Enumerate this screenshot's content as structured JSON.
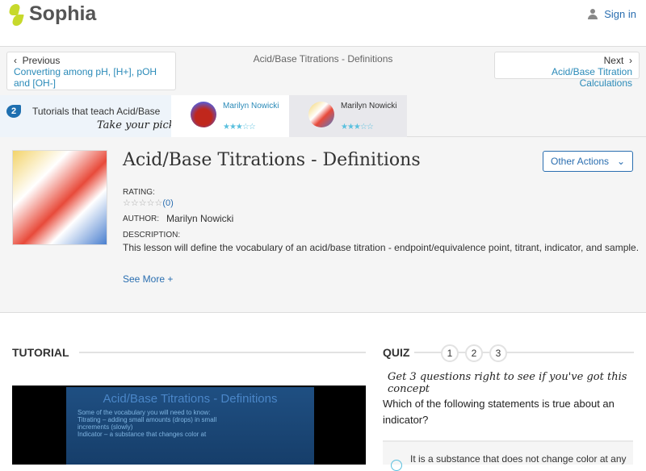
{
  "header": {
    "brand": "Sophia",
    "signin": "Sign in"
  },
  "nav": {
    "previous_label": "Previous",
    "previous_link": "Converting among pH, [H+], pOH and [OH-]",
    "current": "Acid/Base Titrations - Definitions",
    "next_label": "Next",
    "next_link": "Acid/Base Titration Calculations"
  },
  "tutorials": {
    "count": "2",
    "label": "Tutorials that teach Acid/Base T",
    "pick": "Take your pick:",
    "cards": [
      {
        "author": "Marilyn Nowicki",
        "rating": 3
      },
      {
        "author": "Marilyn Nowicki",
        "rating": 3
      }
    ]
  },
  "lesson": {
    "title": "Acid/Base Titrations - Definitions",
    "rating_label": "RATING:",
    "rating_count": "(0)",
    "author_label": "AUTHOR:",
    "author": "Marilyn Nowicki",
    "description_label": "DESCRIPTION:",
    "description": "This lesson will define the vocabulary of an acid/base titration - endpoint/equivalence point, titrant, indicator, and sample.",
    "see_more": "See More +",
    "other_actions": "Other Actions"
  },
  "tutorial": {
    "heading": "TUTORIAL",
    "slide_title": "Acid/Base Titrations - Definitions",
    "slide_intro": "Some of the vocabulary you will need to know:",
    "slide_b1": "Titrating – adding small amounts (drops) in small increments (slowly)",
    "slide_b2": "Indicator – a substance that changes color at"
  },
  "quiz": {
    "heading": "QUIZ",
    "steps": [
      "1",
      "2",
      "3"
    ],
    "prompt": "Get 3 questions right to see if you've got this concept",
    "question": "Which of the following statements is true about an indicator?",
    "option1": "It is a substance that does not change color at any"
  }
}
